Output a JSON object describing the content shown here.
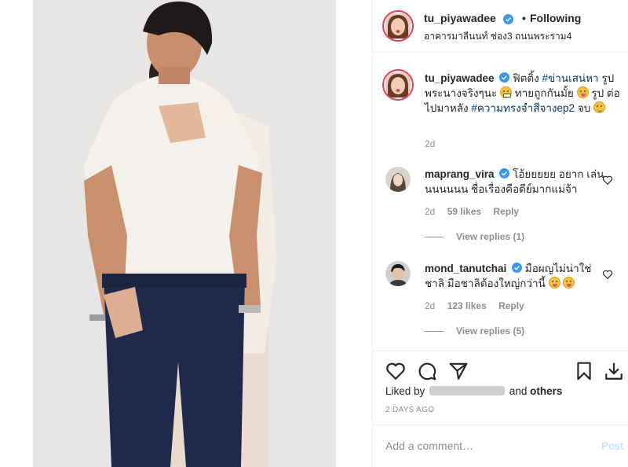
{
  "post": {
    "author": "tu_piyawadee",
    "follow_dot": "•",
    "follow_status": "Following",
    "location": "อาคารมาลีนนท์ ช่อง3 ถนนพระราม4"
  },
  "caption": {
    "username": "tu_piyawadee",
    "text_1": "ฟิตติ้ง",
    "hashtag_1": "#ข่านเสน่หา",
    "text_2": "รูป พระนางจริงๆนะ",
    "text_3": "ทายถูกกันมั้ย",
    "text_4": "รูป ต่อไปมาหลัง",
    "hashtag_2": "#ความทรงจำสีจางep2",
    "text_5": "จบ",
    "time": "2d"
  },
  "comments": [
    {
      "username": "maprang_vira",
      "text": "โอ้ยยยยย อยาก เล่นนนนนนน ชื่อเรื่องคือดีย์มากแม่จ้า",
      "time": "2d",
      "likes": "59 likes",
      "reply": "Reply",
      "replies": "View replies (1)"
    },
    {
      "username": "mond_tanutchai",
      "text": "มือผญไม่น่าใช่ ชาลิ มือชาลิต้องใหญ่กว่านี้",
      "time": "2d",
      "likes": "123 likes",
      "reply": "Reply",
      "replies": "View replies (5)"
    }
  ],
  "liked_by": {
    "prefix": "Liked by",
    "suffix": "and",
    "others": "others"
  },
  "posted_date": "2 DAYS AGO",
  "add_comment": {
    "placeholder": "Add a comment…",
    "post_label": "Post"
  },
  "icons": {
    "like": "heart-icon",
    "comment": "comment-icon",
    "share": "share-icon",
    "save": "bookmark-icon",
    "download": "download-icon",
    "verified": "verified-badge-icon"
  },
  "colors": {
    "verified": "#3897f0",
    "link": "#00376b",
    "muted": "#8e8e8e",
    "post_disabled": "#b2dffc",
    "story_ring": "#e4405f"
  }
}
